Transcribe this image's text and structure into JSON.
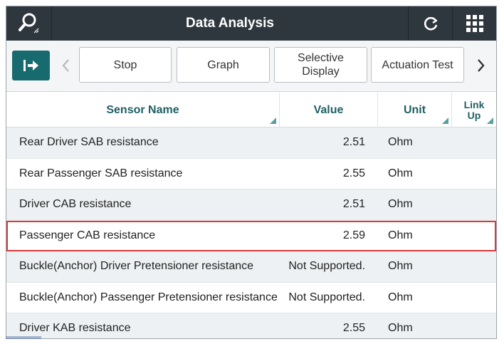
{
  "header": {
    "title": "Data Analysis",
    "search_icon": "search-icon",
    "refresh_icon": "refresh-icon",
    "menu_icon": "grid-menu-icon"
  },
  "toolbar": {
    "exit_icon": "exit-icon",
    "prev_icon": "chevron-left-icon",
    "next_icon": "chevron-right-icon",
    "buttons": {
      "stop": "Stop",
      "graph": "Graph",
      "selective_line1": "Selective",
      "selective_line2": "Display",
      "actuation": "Actuation Test"
    }
  },
  "table": {
    "columns": {
      "name": "Sensor Name",
      "value": "Value",
      "unit": "Unit",
      "link_line1": "Link",
      "link_line2": "Up"
    },
    "rows": [
      {
        "name": "Rear Driver SAB resistance",
        "value": "2.51",
        "unit": "Ohm"
      },
      {
        "name": "Rear Passenger SAB resistance",
        "value": "2.55",
        "unit": "Ohm"
      },
      {
        "name": "Driver CAB resistance",
        "value": "2.51",
        "unit": "Ohm"
      },
      {
        "name": "Passenger CAB resistance",
        "value": "2.59",
        "unit": "Ohm"
      },
      {
        "name": "Buckle(Anchor) Driver Pretensioner resistance",
        "value": "Not Supported.",
        "unit": "Ohm"
      },
      {
        "name": "Buckle(Anchor) Passenger Pretensioner resistance",
        "value": "Not Supported.",
        "unit": "Ohm"
      },
      {
        "name": "Driver KAB resistance",
        "value": "2.55",
        "unit": "Ohm"
      }
    ]
  },
  "colors": {
    "titlebar": "#2f373e",
    "accent": "#176b6f",
    "highlight": "#d93a3a"
  }
}
